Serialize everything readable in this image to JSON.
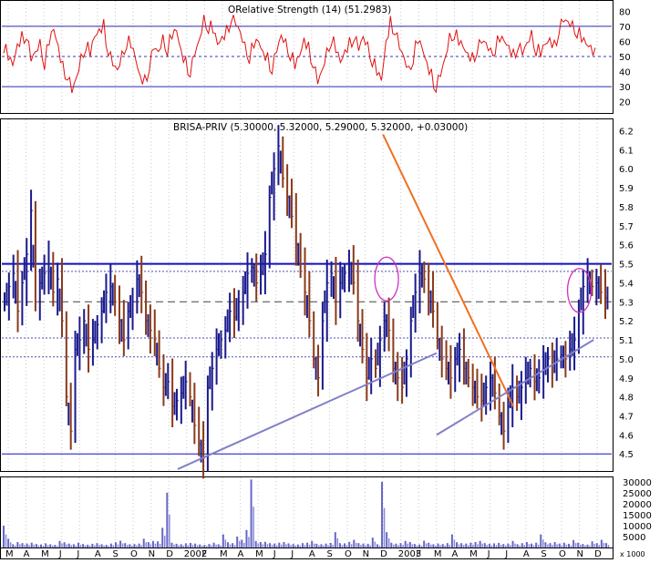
{
  "chart_data": [
    {
      "panel": "rsi",
      "type": "line",
      "title": "ORelative Strength (14) (51.2983)",
      "ylim": [
        15,
        85
      ],
      "yticks": [
        20,
        30,
        40,
        50,
        60,
        70,
        80
      ],
      "reference_lines": [
        30,
        50,
        70
      ],
      "series": [
        {
          "values": [
            57,
            50,
            44,
            56,
            62,
            65,
            48,
            52,
            58,
            46,
            60,
            68,
            55,
            42,
            38,
            27,
            35,
            48,
            58,
            52,
            63,
            66,
            70,
            54,
            45,
            40,
            50,
            60,
            58,
            48,
            35,
            33,
            44,
            56,
            52,
            61,
            55,
            64,
            67,
            52,
            45,
            40,
            52,
            60,
            74,
            70,
            68,
            58,
            61,
            66,
            76,
            72,
            65,
            56,
            50,
            58,
            60,
            51,
            48,
            42,
            54,
            63,
            58,
            52,
            44,
            50,
            60,
            55,
            46,
            33,
            40,
            52,
            62,
            55,
            46,
            52,
            58,
            64,
            55,
            62,
            56,
            48,
            40,
            34,
            58,
            72,
            68,
            56,
            48,
            40,
            50,
            61,
            55,
            44,
            37,
            30,
            38,
            48,
            62,
            66,
            60,
            56,
            50,
            48,
            55,
            60,
            58,
            52,
            56,
            62,
            60,
            55,
            50,
            58,
            52,
            58,
            64,
            55,
            52,
            58,
            60,
            56,
            68,
            74,
            72,
            70,
            67,
            62,
            58,
            55,
            51
          ]
        }
      ]
    },
    {
      "panel": "price",
      "type": "line",
      "title": "BRISA-PRIV (5.30000, 5.32000, 5.29000, 5.32000, +0.03000)",
      "ylim": [
        4.41,
        6.26
      ],
      "yticks": [
        "4.5",
        "4.6",
        "4.7",
        "4.8",
        "4.9",
        "5.0",
        "5.1",
        "5.2",
        "5.3",
        "5.4",
        "5.5",
        "5.6",
        "5.7",
        "5.8",
        "5.9",
        "6.0",
        "6.1",
        "6.2"
      ],
      "x_categories": [
        "M",
        "A",
        "M",
        "J",
        "J",
        "A",
        "S",
        "O",
        "N",
        "D",
        "2002",
        "F",
        "M",
        "A",
        "M",
        "J",
        "J",
        "A",
        "S",
        "O",
        "N",
        "D",
        "2003",
        "F",
        "M",
        "A",
        "M",
        "J",
        "J",
        "A",
        "S",
        "O",
        "N",
        "D"
      ],
      "horizontal_levels": {
        "resistance": 5.5,
        "dashed": [
          5.3,
          5.46,
          5.11,
          5.01
        ],
        "support": 4.5
      },
      "trendlines": [
        {
          "name": "orange downtrend",
          "from": [
            21.0,
            6.18
          ],
          "to": [
            28.3,
            4.75
          ]
        },
        {
          "name": "lower uptrend",
          "from": [
            9.5,
            4.42
          ],
          "to": [
            24.0,
            5.03
          ]
        },
        {
          "name": "recent uptrend",
          "from": [
            24.0,
            4.6
          ],
          "to": [
            32.8,
            5.1
          ]
        }
      ],
      "highlight_circles": [
        {
          "x": 21.2,
          "y": 5.42
        },
        {
          "x": 32.0,
          "y": 5.36
        }
      ],
      "series": [
        {
          "values": [
            5.3,
            5.38,
            5.45,
            5.25,
            5.4,
            5.55,
            5.78,
            5.3,
            5.4,
            5.45,
            5.5,
            5.35,
            5.42,
            5.2,
            4.8,
            4.62,
            5.05,
            5.1,
            5.2,
            5.05,
            5.1,
            5.18,
            5.25,
            5.35,
            5.38,
            5.3,
            5.2,
            5.1,
            5.25,
            5.3,
            5.42,
            5.35,
            5.2,
            5.15,
            5.1,
            4.95,
            4.85,
            4.88,
            4.75,
            4.78,
            4.82,
            4.88,
            4.8,
            4.65,
            4.55,
            4.48,
            4.85,
            4.95,
            5.05,
            5.1,
            5.15,
            5.25,
            5.22,
            5.3,
            5.35,
            5.45,
            5.48,
            5.4,
            5.45,
            5.55,
            5.85,
            6.0,
            6.12,
            5.95,
            5.85,
            5.75,
            5.6,
            5.5,
            5.35,
            5.2,
            5.0,
            4.9,
            5.2,
            5.4,
            5.45,
            5.3,
            5.4,
            5.45,
            5.5,
            5.4,
            5.2,
            5.05,
            4.9,
            5.0,
            4.95,
            5.1,
            5.2,
            5.15,
            4.95,
            4.9,
            4.85,
            5.0,
            5.2,
            5.35,
            5.45,
            5.42,
            5.35,
            5.25,
            5.1,
            5.0,
            4.95,
            4.9,
            5.0,
            5.05,
            4.95,
            4.9,
            4.85,
            4.8,
            4.78,
            4.85,
            4.9,
            4.82,
            4.7,
            4.62,
            4.75,
            4.85,
            4.8,
            4.85,
            4.9,
            4.95,
            4.88,
            4.9,
            4.95,
            5.0,
            4.97,
            5.0,
            5.02,
            5.0,
            5.05,
            5.1,
            5.25,
            5.38,
            5.42,
            5.38,
            5.4,
            5.35,
            5.32
          ]
        }
      ]
    },
    {
      "panel": "volume",
      "type": "bar",
      "ylim": [
        0,
        32000
      ],
      "yticks": [
        "5000",
        "10000",
        "15000",
        "20000",
        "25000",
        "30000"
      ],
      "axis_multiplier": "x 1000",
      "series": [
        {
          "values": [
            10000,
            4000,
            1500,
            2500,
            2000,
            1800,
            2200,
            1600,
            1400,
            1900,
            1500,
            1200,
            3000,
            2400,
            1800,
            1500,
            2200,
            1600,
            1300,
            1700,
            2000,
            1500,
            1200,
            1800,
            2400,
            3100,
            2000,
            1500,
            1600,
            1800,
            4000,
            2500,
            3000,
            2800,
            9000,
            25000,
            2200,
            1700,
            1500,
            1900,
            2100,
            1800,
            1400,
            1200,
            1600,
            2200,
            1500,
            6000,
            2400,
            2000,
            5000,
            3500,
            8000,
            31000,
            3000,
            2500,
            2600,
            2000,
            1800,
            2200,
            2500,
            1900,
            1600,
            1400,
            2000,
            2200,
            3000,
            1700,
            1500,
            1800,
            2100,
            7000,
            2000,
            1900,
            2600,
            3500,
            2000,
            1800,
            1700,
            4500,
            1500,
            30000,
            7000,
            2200,
            1800,
            2000,
            3000,
            2500,
            1600,
            1400,
            3100,
            2200,
            1500,
            1800,
            1600,
            2000,
            6000,
            2400,
            2000,
            1800,
            2200,
            2500,
            3000,
            2000,
            1700,
            1900,
            2100,
            1600,
            1800,
            3000,
            1500,
            2000,
            2500,
            1800,
            2200,
            6000,
            2400,
            2000,
            2500,
            1800,
            2200,
            1700,
            3400,
            2200,
            1600,
            1300,
            2800,
            2000,
            3500,
            2000
          ]
        }
      ]
    }
  ]
}
